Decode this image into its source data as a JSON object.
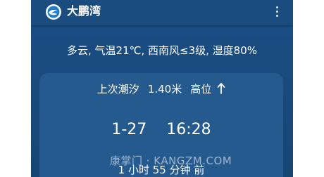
{
  "app": {
    "title": "大鹏湾",
    "logo_icon": "app-logo-icon",
    "menu_icon": "more-vertical-icon"
  },
  "weather": {
    "summary": "多云, 气温21℃, 西南风≤3级, 湿度80%"
  },
  "tide": {
    "label": "上次潮汐",
    "height": "1.40米",
    "level": "高位",
    "direction_icon": "arrow-up-icon",
    "date": "1-27",
    "time": "16:28",
    "elapsed": "1 小时 55 分钟 前"
  },
  "watermark": {
    "text": "康掌门 · KANGZM.COM"
  },
  "colors": {
    "background": "#1b4f86",
    "appbar": "#1a4c80",
    "card": "#255a8f",
    "text": "#ffffff"
  }
}
